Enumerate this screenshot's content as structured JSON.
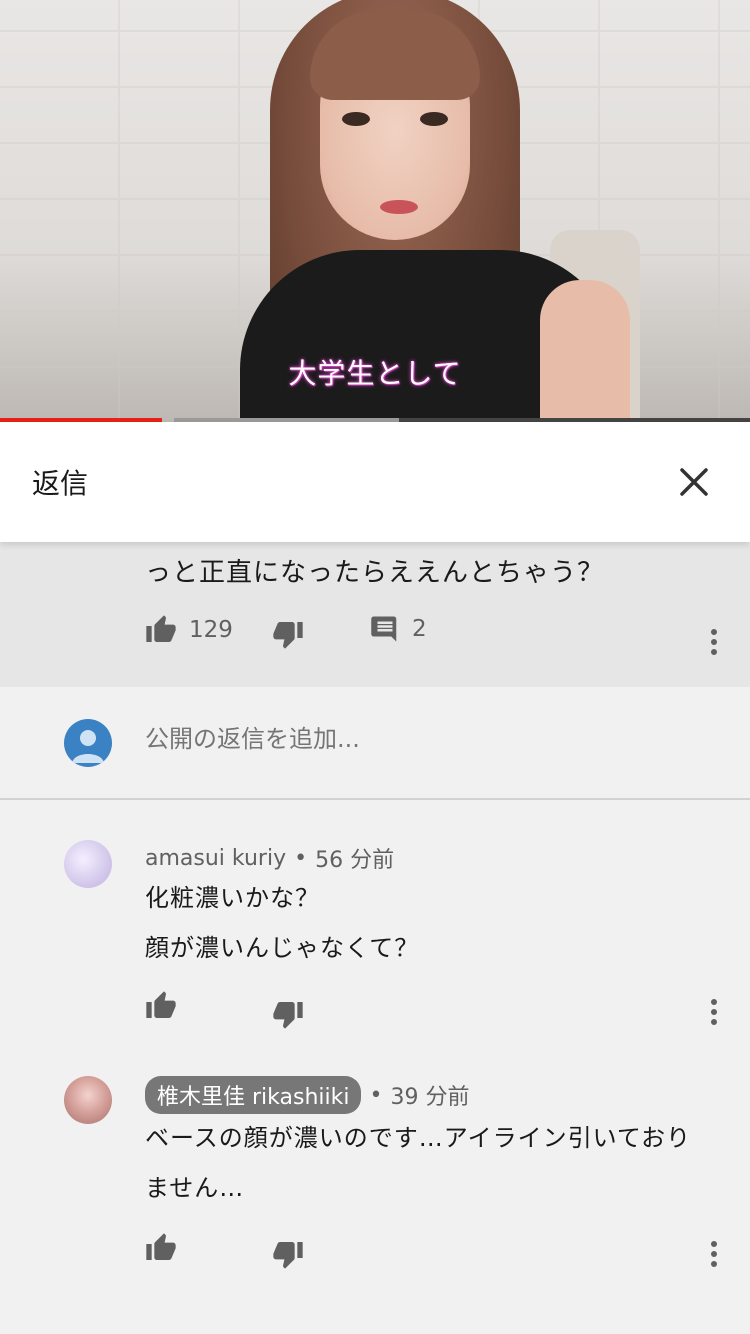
{
  "video": {
    "caption": "大学生として",
    "progress_played": 0.216,
    "progress_buffered_end": 0.532
  },
  "header": {
    "title": "返信"
  },
  "parent_comment": {
    "text_tail": "っと正直になったらええんとちゃう？",
    "likes": "129",
    "replies": "2"
  },
  "add_reply": {
    "placeholder": "公開の返信を追加..."
  },
  "replies": [
    {
      "author": "amasui kuriy",
      "time": "56 分前",
      "lines": [
        "化粧濃いかな？",
        "顔が濃いんじゃなくて？"
      ]
    },
    {
      "author": "椎木里佳 rikashiiki",
      "time": "39 分前",
      "lines": [
        "ベースの顔が濃いのです…アイライン引いており",
        "ません…"
      ]
    }
  ],
  "colors": {
    "progress": "#e62117",
    "header_bg": "#ffffff",
    "parent_bg": "#e6e6e6",
    "page_bg": "#f1f1f1"
  },
  "icons": [
    "close-icon",
    "thumb-up-icon",
    "thumb-down-icon",
    "comment-icon",
    "more-vert-icon",
    "avatar-icon"
  ]
}
